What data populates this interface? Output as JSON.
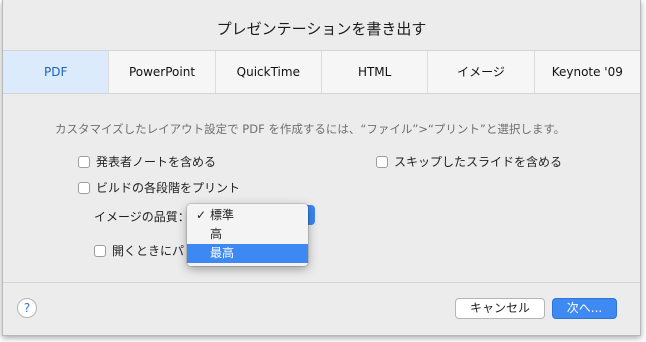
{
  "dialog": {
    "title": "プレゼンテーションを書き出す"
  },
  "tabs": [
    {
      "label": "PDF",
      "active": true
    },
    {
      "label": "PowerPoint",
      "active": false
    },
    {
      "label": "QuickTime",
      "active": false
    },
    {
      "label": "HTML",
      "active": false
    },
    {
      "label": "イメージ",
      "active": false
    },
    {
      "label": "Keynote '09",
      "active": false
    }
  ],
  "description": "カスタマイズしたレイアウト設定で PDF を作成するには、“ファイル”>“プリント”と選択します。",
  "options": {
    "presenter_notes": "発表者ノートを含める",
    "build_stages": "ビルドの各段階をプリント",
    "skipped_slides": "スキップしたスライドを含める",
    "open_when_done": "開くときにパ"
  },
  "image_quality": {
    "label": "イメージの品質：",
    "checkmark": "✓",
    "items": [
      "標準",
      "高",
      "最高"
    ],
    "checked_index": 0,
    "highlighted_index": 2
  },
  "footer": {
    "help": "?",
    "cancel": "キャンセル",
    "next": "次へ..."
  },
  "colors": {
    "accent": "#3d88f2",
    "active_tab_bg": "#dcebfb",
    "active_tab_text": "#1b62c2"
  }
}
